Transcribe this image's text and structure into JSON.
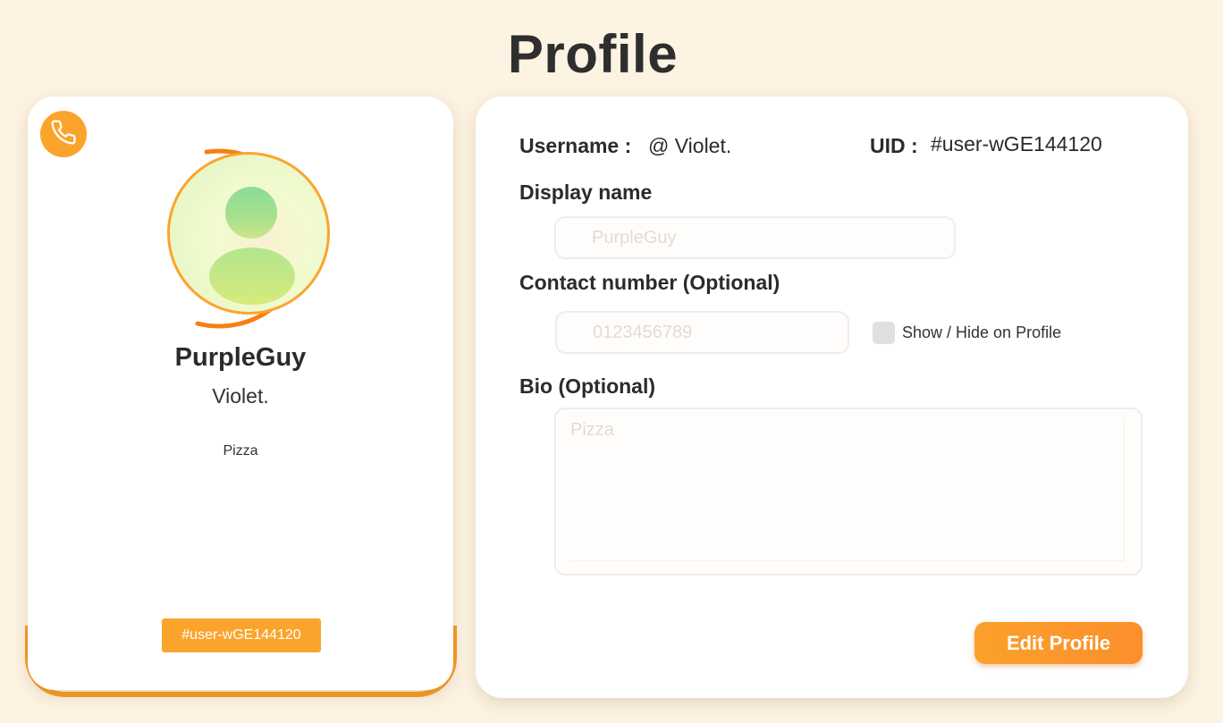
{
  "page": {
    "title": "Profile"
  },
  "card": {
    "display_name": "PurpleGuy",
    "handle": "Violet.",
    "bio": "Pizza",
    "uid_badge": "#user-wGE144120",
    "call_icon": "phone-icon",
    "avatar_icon": "user-avatar-icon"
  },
  "form": {
    "username_label": "Username :",
    "username_value": "@ Violet.",
    "uid_label": "UID :",
    "uid_value": "#user-wGE144120",
    "display_name_label": "Display name",
    "display_name_placeholder": "PurpleGuy",
    "contact_label": "Contact number (Optional)",
    "contact_placeholder": "0123456789",
    "show_hide_label": "Show / Hide on Profile",
    "bio_label": "Bio (Optional)",
    "bio_placeholder": "Pizza",
    "edit_button_label": "Edit Profile"
  },
  "colors": {
    "accent": "#fba42c",
    "background": "#fdf3e3"
  }
}
